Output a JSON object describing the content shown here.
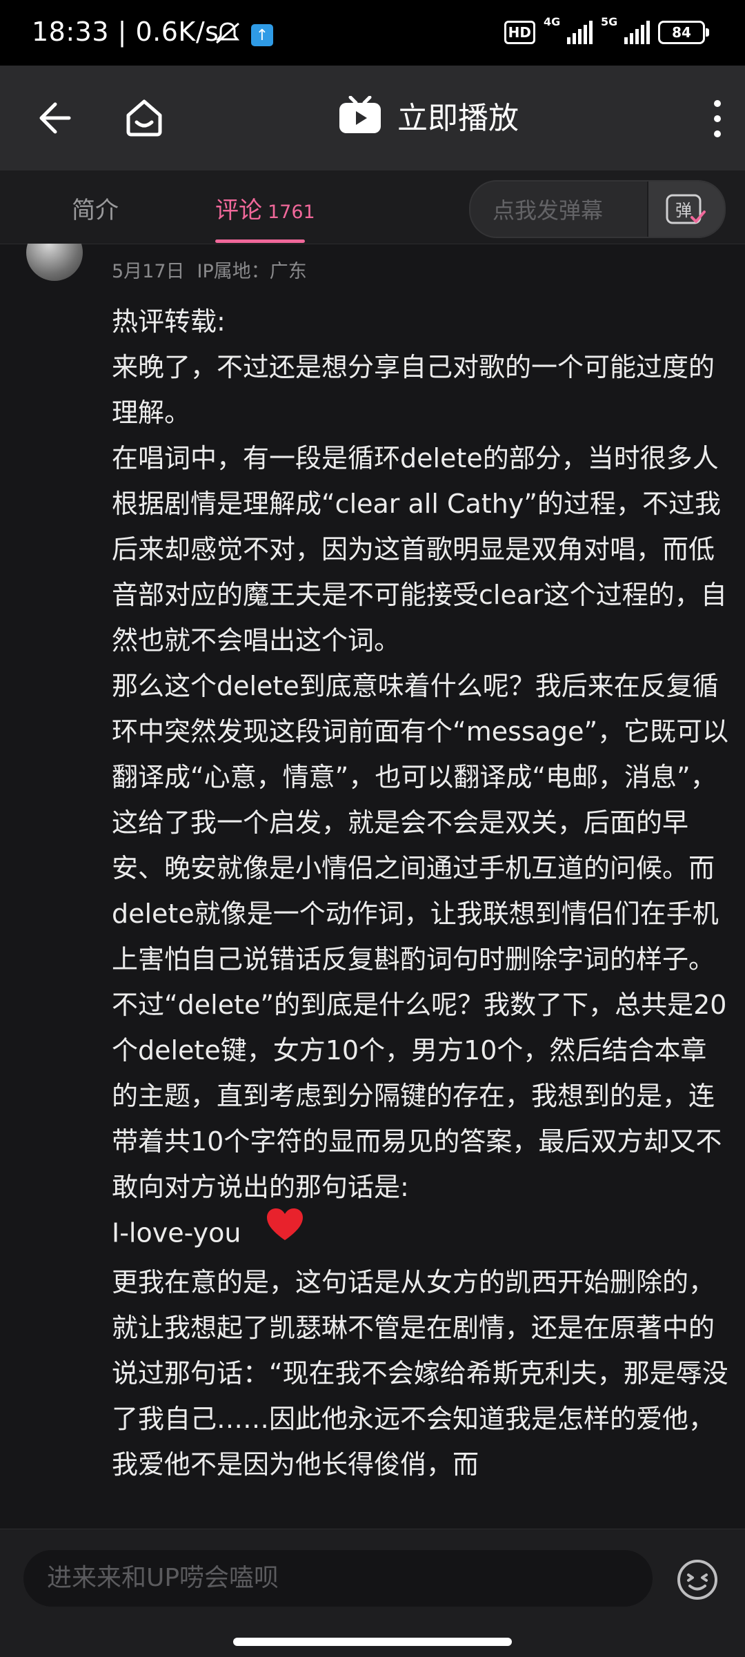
{
  "status_bar": {
    "time": "18:33 | 0.6K/s",
    "hd_label": "HD",
    "signal1_label": "4G",
    "signal2_label": "5G",
    "battery": "84"
  },
  "top_bar": {
    "title": "立即播放"
  },
  "tabs": {
    "intro": "简介",
    "comments": "评论",
    "comments_count": "1761",
    "danmaku_placeholder": "点我发弹幕",
    "danmaku_button": "弹"
  },
  "comment": {
    "date": "5月17日",
    "ip": "IP属地：广东",
    "paragraphs": [
      "热评转载:",
      "来晚了，不过还是想分享自己对歌的一个可能过度的理解。",
      "在唱词中，有一段是循环delete的部分，当时很多人根据剧情是理解成“clear all Cathy”的过程，不过我后来却感觉不对，因为这首歌明显是双角对唱，而低音部对应的魔王夫是不可能接受clear这个过程的，自然也就不会唱出这个词。",
      "那么这个delete到底意味着什么呢？我后来在反复循环中突然发现这段词前面有个“message”，它既可以翻译成“心意，情意”，也可以翻译成“电邮，消息”，这给了我一个启发，就是会不会是双关，后面的早安、晚安就像是小情侣之间通过手机互道的问候。而delete就像是一个动作词，让我联想到情侣们在手机上害怕自己说错话反复斟酌词句时删除字词的样子。不过“delete”的到底是什么呢？我数了下，总共是20个delete键，女方10个，男方10个，然后结合本章的主题，直到考虑到分隔键的存在，我想到的是，连带着共10个字符的显而易见的答案，最后双方却又不敢向对方说出的那句话是:",
      "I-love-you",
      "更我在意的是，这句话是从女方的凯西开始删除的，就让我想起了凯瑟琳不管是在剧情，还是在原著中的说过那句话：“现在我不会嫁给希斯克利夫，那是辱没了我自己……因此他永远不会知道我是怎样的爱他，我爱他不是因为他长得俊俏，而"
    ]
  },
  "bottom_bar": {
    "reply_placeholder": "进来来和UP唠会嗑呗"
  }
}
